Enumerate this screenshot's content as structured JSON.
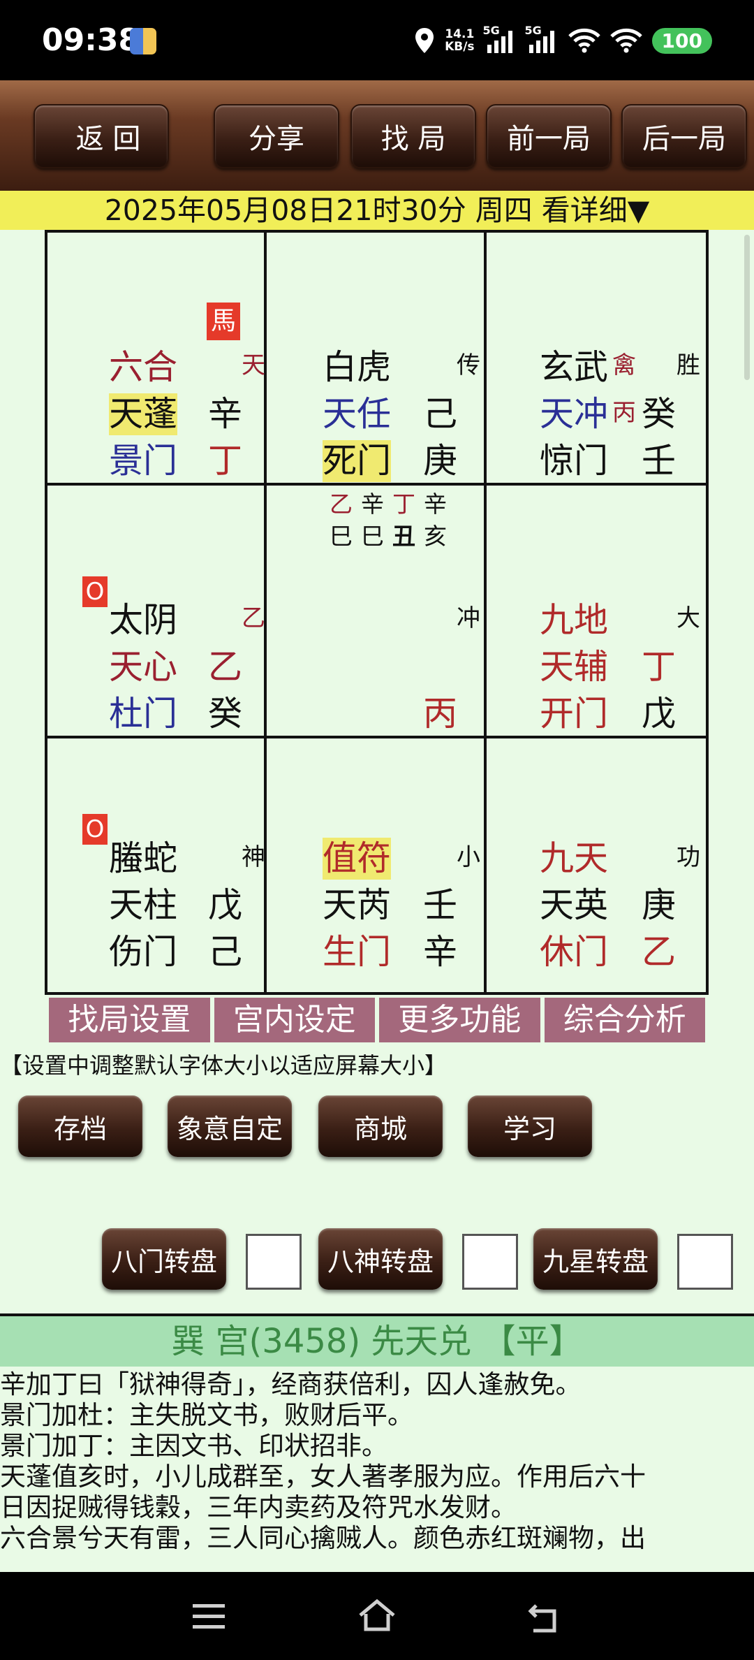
{
  "status_bar": {
    "time": "09:38",
    "net_speed_value": "14.1",
    "net_speed_unit": "KB/s",
    "sim1_label": "5G",
    "sim2_label": "5G",
    "battery": "100"
  },
  "toolbar": {
    "back": "返 回",
    "share": "分享",
    "find": "找 局",
    "prev": "前一局",
    "next": "后一局"
  },
  "date_line": "2025年05月08日21时30分 周四 看详细▼",
  "grid": {
    "nw": {
      "badge": "馬",
      "god": "六合",
      "god_tag": "天",
      "star": "天蓬",
      "star_stem": "辛",
      "door": "景门",
      "door_stem": "丁"
    },
    "n": {
      "god": "白虎",
      "god_tag": "传",
      "star": "天任",
      "star_stem": "己",
      "door": "死门",
      "door_stem": "庚"
    },
    "ne": {
      "god": "玄武",
      "god_tag_red": "禽",
      "god_tag": "胜",
      "star": "天冲",
      "star_mid": "丙",
      "star_stem": "癸",
      "door": "惊门",
      "door_stem": "壬"
    },
    "w": {
      "badge": "O",
      "god": "太阴",
      "god_tag": "乙",
      "star": "天心",
      "star_stem": "乙",
      "door": "杜门",
      "door_stem": "癸"
    },
    "c": {
      "pillars_top": [
        "乙",
        "辛",
        "丁",
        "辛"
      ],
      "pillars_bottom": [
        "巳",
        "巳",
        "丑",
        "亥"
      ],
      "tag": "冲",
      "stem": "丙"
    },
    "e": {
      "god": "九地",
      "god_tag": "大",
      "star": "天辅",
      "star_stem": "丁",
      "door": "开门",
      "door_stem": "戊"
    },
    "sw": {
      "badge": "O",
      "god": "螣蛇",
      "god_tag": "神",
      "star": "天柱",
      "star_stem": "戊",
      "door": "伤门",
      "door_stem": "己"
    },
    "s": {
      "god": "值符",
      "god_tag": "小",
      "star": "天芮",
      "star_stem": "壬",
      "door": "生门",
      "door_stem": "辛"
    },
    "se": {
      "god": "九天",
      "god_tag": "功",
      "star": "天英",
      "star_stem": "庚",
      "door": "休门",
      "door_stem": "乙"
    }
  },
  "tabs": [
    "找局设置",
    "宫内设定",
    "更多功能",
    "综合分析"
  ],
  "hint": "【设置中调整默认字体大小以适应屏幕大小】",
  "buttons": {
    "archive": "存档",
    "custom": "象意自定",
    "mall": "商城",
    "learn": "学习",
    "door_rotate": "八门转盘",
    "god_rotate": "八神转盘",
    "star_rotate": "九星转盘"
  },
  "palace": {
    "header": "巽 宫(3458) 先天兑  【平】",
    "lines": [
      "辛加丁曰「狱神得奇」，经商获倍利，囚人逢赦免。",
      "景门加杜：主失脱文书，败财后平。",
      "景门加丁：主因文书、印状招非。",
      "天蓬值亥时，小儿成群至，女人著孝服为应。作用后六十",
      "日因捉贼得钱穀，三年内卖药及符咒水发财。",
      "六合景兮天有雷，三人同心擒贼人。颜色赤红斑斓物，出"
    ]
  }
}
